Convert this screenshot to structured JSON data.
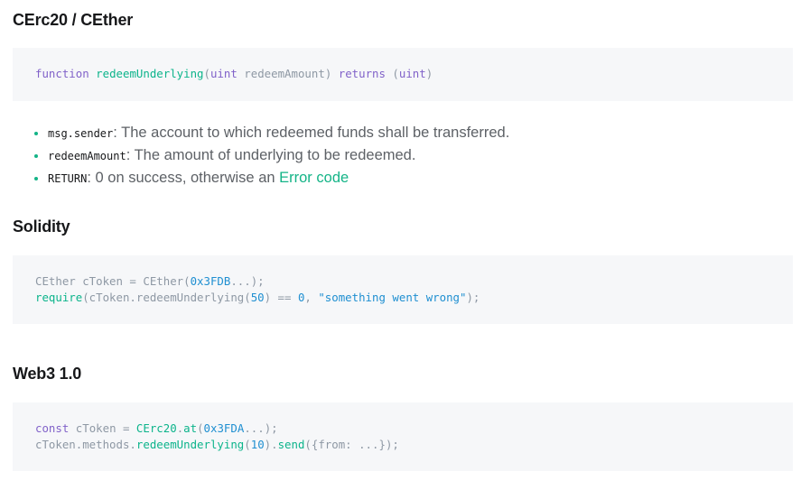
{
  "section1": {
    "heading": "CErc20 / CEther",
    "code": {
      "kw_function": "function",
      "fn_name": "redeemUnderlying",
      "open_paren": "(",
      "param_type": "uint",
      "param_name": " redeemAmount",
      "close_paren": ") ",
      "kw_returns": "returns",
      "ret_open": " (",
      "ret_type": "uint",
      "ret_close": ")"
    }
  },
  "params": [
    {
      "code": "msg.sender",
      "desc": ": The account to which redeemed funds shall be transferred."
    },
    {
      "code": "redeemAmount",
      "desc": ": The amount of underlying to be redeemed."
    },
    {
      "code": "RETURN",
      "desc": ": 0 on success, otherwise an ",
      "link": "Error code"
    }
  ],
  "section2": {
    "heading": "Solidity",
    "line1": {
      "a": "CEther cToken = CEther(",
      "num": "0x3FDB",
      "b": "...);"
    },
    "line2": {
      "fn": "require",
      "a": "(cToken.redeemUnderlying(",
      "num1": "50",
      "b": ") == ",
      "num2": "0",
      "c": ", ",
      "str": "\"something went wrong\"",
      "d": ");"
    }
  },
  "section3": {
    "heading": "Web3 1.0",
    "line1": {
      "kw": "const",
      "a": " cToken = ",
      "cls": "CErc20",
      "b": ".",
      "fn": "at",
      "c": "(",
      "num": "0x3FDA",
      "d": "...);"
    },
    "line2": {
      "a": "cToken.methods.",
      "fn": "redeemUnderlying",
      "b": "(",
      "num": "10",
      "c": ").",
      "fn2": "send",
      "d": "({from: ...});"
    }
  },
  "colors": {
    "accent": "#14b487",
    "keyword": "#8162c9",
    "number": "#1f8fd1",
    "code_text": "#8e98a4",
    "code_bg": "#f6f7f9"
  }
}
